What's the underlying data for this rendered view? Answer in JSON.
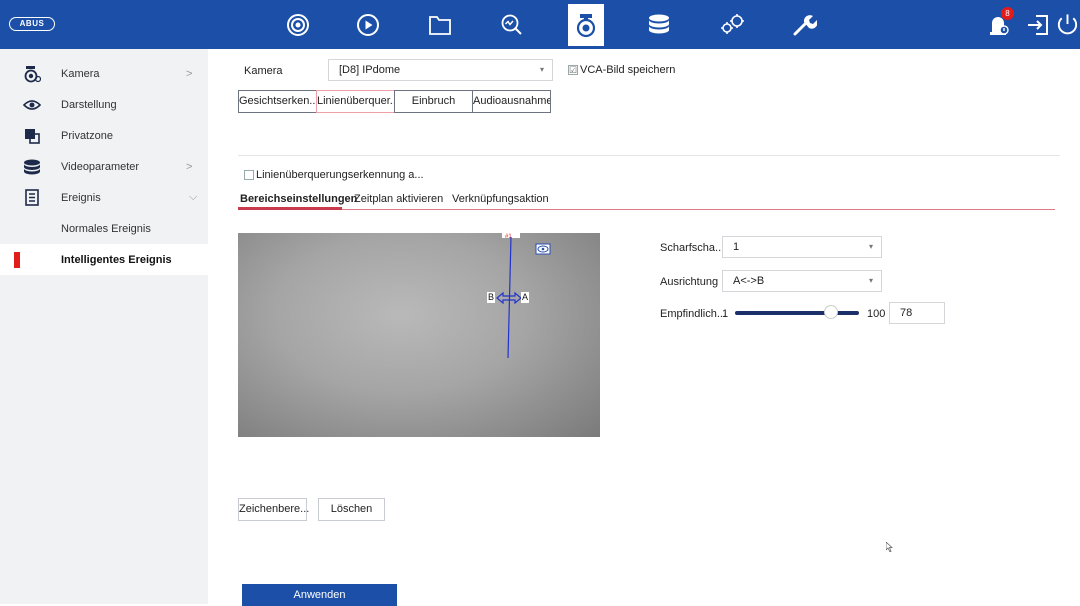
{
  "topbar": {
    "logo": "ABUS",
    "badge_count": "8",
    "icons": [
      "live-view-icon",
      "playback-icon",
      "file-icon",
      "smart-search-icon",
      "camera-config-icon",
      "storage-icon",
      "system-config-icon",
      "maintenance-icon",
      "alarm-icon",
      "logout-icon",
      "power-icon"
    ],
    "accent": "#1b4fa8"
  },
  "sidebar": {
    "items": [
      {
        "label": "Kamera",
        "icon": "camera-icon",
        "chevron": ">"
      },
      {
        "label": "Darstellung",
        "icon": "eye-icon",
        "chevron": ""
      },
      {
        "label": "Privatzone",
        "icon": "privacy-mask-icon",
        "chevron": ""
      },
      {
        "label": "Videoparameter",
        "icon": "database-icon",
        "chevron": ">"
      },
      {
        "label": "Ereignis",
        "icon": "document-icon",
        "chevron": "⌵"
      },
      {
        "label": "Normales Ereignis",
        "icon": "",
        "chevron": ""
      },
      {
        "label": "Intelligentes Ereignis",
        "icon": "",
        "chevron": ""
      }
    ]
  },
  "main": {
    "camera_label": "Kamera",
    "camera_value": "[D8] IPdome",
    "vca_label": "VCA-Bild speichern",
    "vca_checked": "☑",
    "tabs": [
      "Gesichtserken...",
      "Linienüberquer...",
      "Einbruch",
      "Audioausnahme"
    ],
    "enable_label": "Linienüberquerungserkennung a...",
    "subtabs": [
      "Bereichseinstellungen",
      "Zeitplan aktivieren",
      "Verknüpfungsaktion"
    ],
    "video_overlay": {
      "line_a": "A",
      "line_b": "B",
      "line_number": "#1"
    },
    "settings": {
      "line_label": "Scharfscha...",
      "line_value": "1",
      "direction_label": "Ausrichtung",
      "direction_value": "A<->B",
      "sensitivity_label": "Empfindlich...",
      "sensitivity_min": "1",
      "sensitivity_max": "100",
      "sensitivity_value": "78"
    },
    "draw_button": "Zeichenbere...",
    "clear_button": "Löschen",
    "apply_button": "Anwenden"
  }
}
